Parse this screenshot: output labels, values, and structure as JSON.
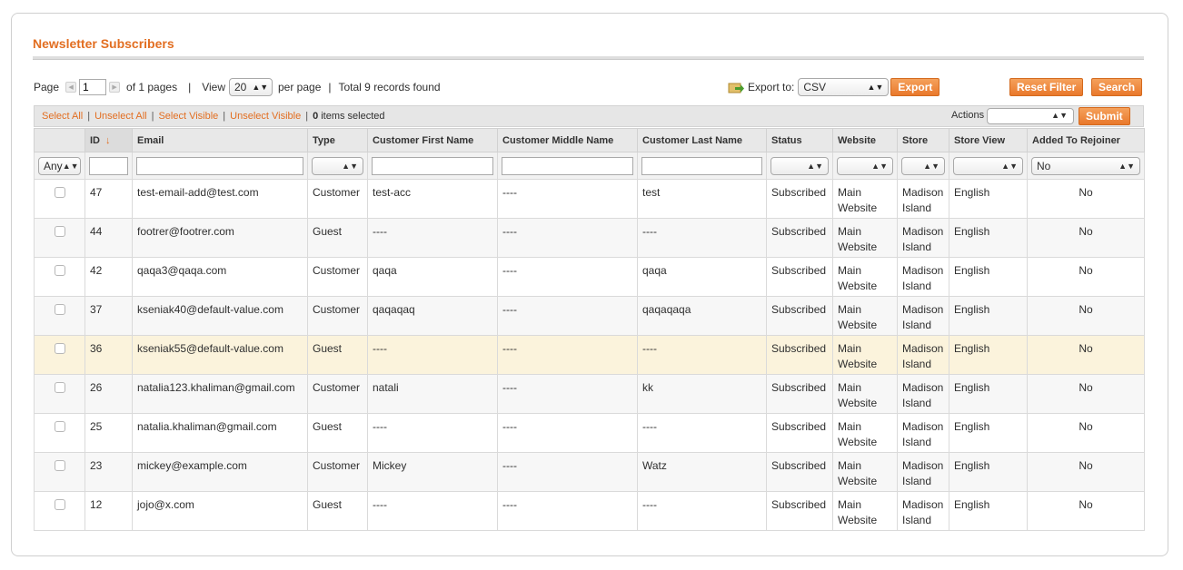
{
  "title": "Newsletter Subscribers",
  "pager": {
    "page_label": "Page",
    "page_value": "1",
    "of_pages": "of 1 pages",
    "view_label": "View",
    "per_page_value": "20",
    "per_page_label": "per page",
    "total": "Total 9 records found"
  },
  "export": {
    "label": "Export to:",
    "format": "CSV",
    "button": "Export"
  },
  "buttons": {
    "reset": "Reset Filter",
    "search": "Search",
    "submit": "Submit"
  },
  "massaction": {
    "select_all": "Select All",
    "unselect_all": "Unselect All",
    "select_visible": "Select Visible",
    "unselect_visible": "Unselect Visible",
    "count": "0",
    "count_suffix": "items selected",
    "actions_label": "Actions",
    "actions_value": ""
  },
  "columns": {
    "id": "ID",
    "email": "Email",
    "type": "Type",
    "first": "Customer First Name",
    "middle": "Customer Middle Name",
    "last": "Customer Last Name",
    "status": "Status",
    "website": "Website",
    "store": "Store",
    "view": "Store View",
    "rejoiner": "Added To Rejoiner"
  },
  "filters": {
    "checkbox": "Any",
    "rejoiner": "No"
  },
  "rows": [
    {
      "id": "47",
      "email": "test-email-add@test.com",
      "type": "Customer",
      "first": "test-acc",
      "middle": "----",
      "last": "test",
      "status": "Subscribed",
      "website": "Main Website",
      "store": "Madison Island",
      "view": "English",
      "rejoiner": "No"
    },
    {
      "id": "44",
      "email": "footrer@footrer.com",
      "type": "Guest",
      "first": "----",
      "middle": "----",
      "last": "----",
      "status": "Subscribed",
      "website": "Main Website",
      "store": "Madison Island",
      "view": "English",
      "rejoiner": "No"
    },
    {
      "id": "42",
      "email": "qaqa3@qaqa.com",
      "type": "Customer",
      "first": "qaqa",
      "middle": "----",
      "last": "qaqa",
      "status": "Subscribed",
      "website": "Main Website",
      "store": "Madison Island",
      "view": "English",
      "rejoiner": "No"
    },
    {
      "id": "37",
      "email": "kseniak40@default-value.com",
      "type": "Customer",
      "first": "qaqaqaq",
      "middle": "----",
      "last": "qaqaqaqa",
      "status": "Subscribed",
      "website": "Main Website",
      "store": "Madison Island",
      "view": "English",
      "rejoiner": "No"
    },
    {
      "id": "36",
      "email": "kseniak55@default-value.com",
      "type": "Guest",
      "first": "----",
      "middle": "----",
      "last": "----",
      "status": "Subscribed",
      "website": "Main Website",
      "store": "Madison Island",
      "view": "English",
      "rejoiner": "No"
    },
    {
      "id": "26",
      "email": "natalia123.khaliman@gmail.com",
      "type": "Customer",
      "first": "natali",
      "middle": "----",
      "last": "kk",
      "status": "Subscribed",
      "website": "Main Website",
      "store": "Madison Island",
      "view": "English",
      "rejoiner": "No"
    },
    {
      "id": "25",
      "email": "natalia.khaliman@gmail.com",
      "type": "Guest",
      "first": "----",
      "middle": "----",
      "last": "----",
      "status": "Subscribed",
      "website": "Main Website",
      "store": "Madison Island",
      "view": "English",
      "rejoiner": "No"
    },
    {
      "id": "23",
      "email": "mickey@example.com",
      "type": "Customer",
      "first": "Mickey",
      "middle": "----",
      "last": "Watz",
      "status": "Subscribed",
      "website": "Main Website",
      "store": "Madison Island",
      "view": "English",
      "rejoiner": "No"
    },
    {
      "id": "12",
      "email": "jojo@x.com",
      "type": "Guest",
      "first": "----",
      "middle": "----",
      "last": "----",
      "status": "Subscribed",
      "website": "Main Website",
      "store": "Madison Island",
      "view": "English",
      "rejoiner": "No"
    }
  ],
  "colors": {
    "accent": "#e26e21",
    "highlight_row": "#fbf3dc"
  }
}
